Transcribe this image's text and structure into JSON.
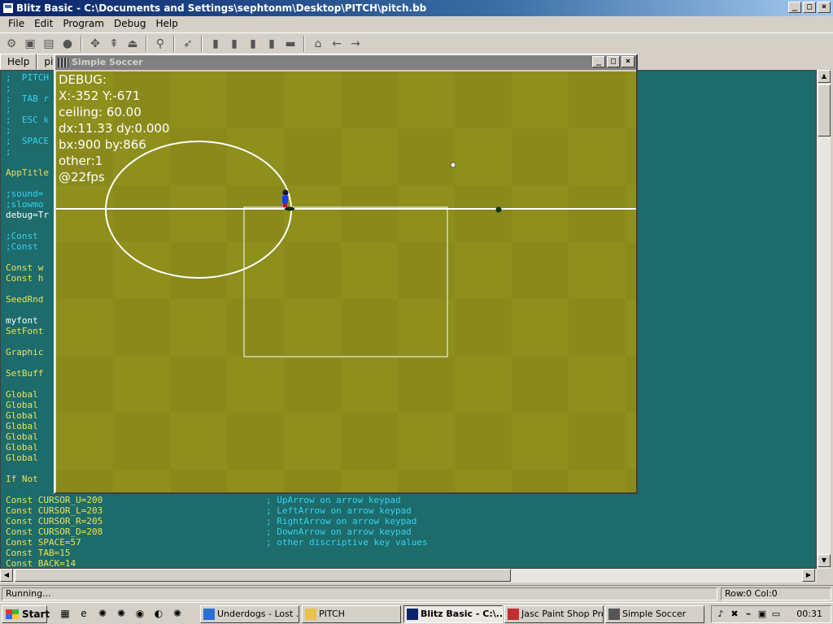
{
  "window": {
    "title": "Blitz Basic - C:\\Documents and Settings\\sephtonm\\Desktop\\PITCH\\pitch.bb",
    "min": "_",
    "max": "□",
    "close": "×"
  },
  "menus": [
    {
      "label": "File"
    },
    {
      "label": "Edit"
    },
    {
      "label": "Program"
    },
    {
      "label": "Debug"
    },
    {
      "label": "Help"
    }
  ],
  "toolbar_icons": [
    "new-icon",
    "open-icon",
    "save-icon",
    "pin-icon",
    "sep",
    "cut-icon",
    "copy-icon",
    "paste-icon",
    "sep",
    "find-icon",
    "sep",
    "run-icon",
    "sep",
    "step-icon",
    "step-over-icon",
    "step-out-icon",
    "stop-icon",
    "debug-icon",
    "sep",
    "home-icon",
    "back-arrow-icon",
    "forward-arrow-icon"
  ],
  "tabs": [
    {
      "label": "Help"
    },
    {
      "label": "pit"
    }
  ],
  "code_lines": [
    {
      "text": ";  PITCH",
      "kind": "comment"
    },
    {
      "text": ";",
      "kind": "comment"
    },
    {
      "text": ";  TAB r",
      "kind": "comment"
    },
    {
      "text": ";",
      "kind": "comment"
    },
    {
      "text": ";  ESC k",
      "kind": "comment"
    },
    {
      "text": ";",
      "kind": "comment"
    },
    {
      "text": ";  SPACE",
      "kind": "comment"
    },
    {
      "text": ";",
      "kind": "comment"
    },
    {
      "text": "",
      "kind": "id"
    },
    {
      "text": "AppTitle",
      "kind": "kw"
    },
    {
      "text": "",
      "kind": "id"
    },
    {
      "text": ";sound=",
      "kind": "comment"
    },
    {
      "text": ";slowmo",
      "kind": "comment"
    },
    {
      "text": "debug=Tr",
      "kind": "id"
    },
    {
      "text": "",
      "kind": "id"
    },
    {
      "text": ";Const ",
      "kind": "comment"
    },
    {
      "text": ";Const ",
      "kind": "comment"
    },
    {
      "text": "",
      "kind": "id"
    },
    {
      "text": "Const w",
      "kind": "kw"
    },
    {
      "text": "Const h",
      "kind": "kw"
    },
    {
      "text": "",
      "kind": "id"
    },
    {
      "text": "SeedRnd",
      "kind": "kw"
    },
    {
      "text": "",
      "kind": "id"
    },
    {
      "text": "myfont",
      "kind": "id"
    },
    {
      "text": "SetFont",
      "kind": "kw"
    },
    {
      "text": "",
      "kind": "id"
    },
    {
      "text": "Graphic",
      "kind": "kw"
    },
    {
      "text": "",
      "kind": "id"
    },
    {
      "text": "SetBuff",
      "kind": "kw"
    },
    {
      "text": "",
      "kind": "id"
    },
    {
      "text": "Global ",
      "kind": "kw"
    },
    {
      "text": "Global ",
      "kind": "kw"
    },
    {
      "text": "Global ",
      "kind": "kw"
    },
    {
      "text": "Global ",
      "kind": "kw"
    },
    {
      "text": "Global ",
      "kind": "kw"
    },
    {
      "text": "Global ",
      "kind": "kw"
    },
    {
      "text": "Global ",
      "kind": "kw"
    },
    {
      "text": "",
      "kind": "id"
    },
    {
      "text": "If Not ",
      "kind": "kw"
    },
    {
      "text": "",
      "kind": "id"
    },
    {
      "text": "Const CURSOR_U=200",
      "kind": "kw",
      "comment": "; UpArrow on arrow keypad"
    },
    {
      "text": "Const CURSOR_L=203",
      "kind": "kw",
      "comment": "; LeftArrow on arrow keypad"
    },
    {
      "text": "Const CURSOR_R=205",
      "kind": "kw",
      "comment": "; RightArrow on arrow keypad"
    },
    {
      "text": "Const CURSOR_D=208",
      "kind": "kw",
      "comment": "; DownArrow on arrow keypad"
    },
    {
      "text": "Const SPACE=57",
      "kind": "kw",
      "comment": "; other discriptive key values"
    },
    {
      "text": "Const TAB=15",
      "kind": "kw"
    },
    {
      "text": "Const BACK=14",
      "kind": "kw"
    }
  ],
  "status": {
    "left": "Running...",
    "right": "Row:0 Col:0"
  },
  "game_window": {
    "title": "Simple Soccer",
    "min": "_",
    "max": "□",
    "close": "×",
    "debug_lines": [
      "DEBUG:",
      "X:-352 Y:-671",
      "ceiling: 60.00",
      "dx:11.33 dy:0.000",
      "bx:900 by:866",
      "other:1",
      "@22fps"
    ],
    "colors": {
      "grass": "#8e8f1c",
      "lines": "#ffffff",
      "player_shirt": "#1a3cf0"
    }
  },
  "taskbar": {
    "start_label": "Start",
    "quicklaunch": [
      "desktop-icon",
      "ie-icon",
      "app-icon",
      "app-icon",
      "winamp-icon",
      "media-icon",
      "app-icon"
    ],
    "tasks": [
      {
        "label": "Underdogs - Lost ...",
        "active": false,
        "icon": "ie-icon"
      },
      {
        "label": "PITCH",
        "active": false,
        "icon": "folder-icon"
      },
      {
        "label": "Blitz Basic - C:\\...",
        "active": true,
        "icon": "blitz-icon"
      },
      {
        "label": "Jasc Paint Shop Pro",
        "active": false,
        "icon": "paint-icon"
      },
      {
        "label": "Simple Soccer",
        "active": false,
        "icon": "game-icon"
      }
    ],
    "tray_icons": [
      "volume-icon",
      "network-icon",
      "usb-icon",
      "monitor-icon",
      "display-icon"
    ],
    "clock": "00:31"
  }
}
